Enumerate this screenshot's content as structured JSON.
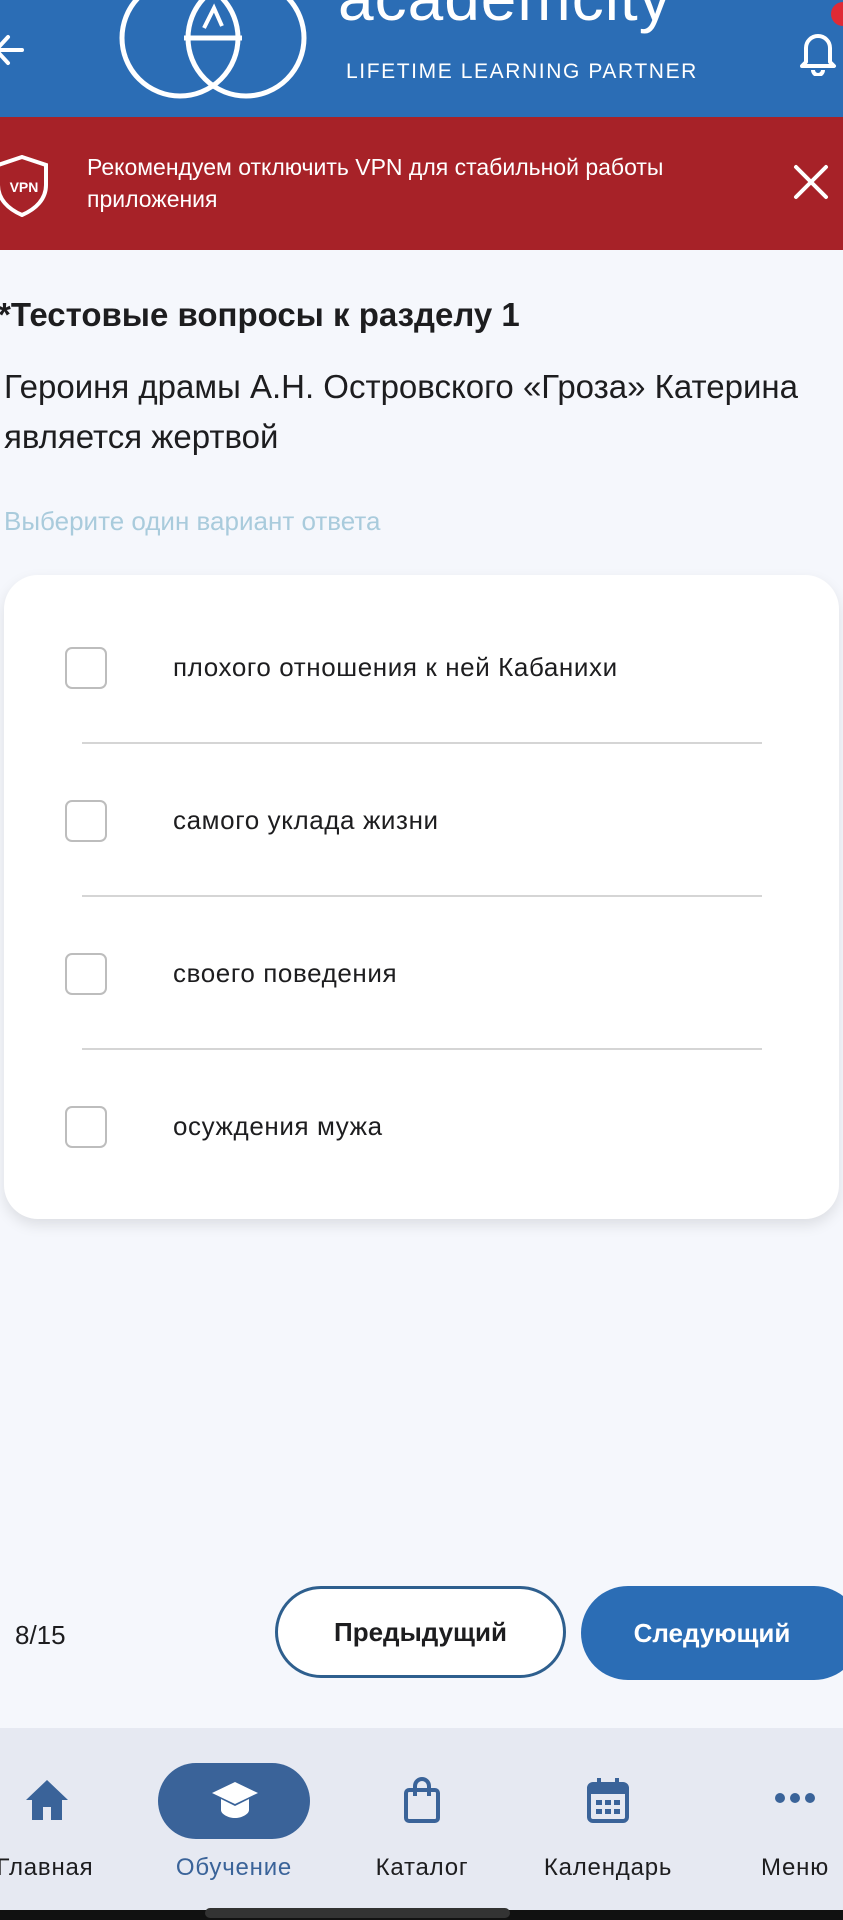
{
  "header": {
    "brand_name": "academcity",
    "brand_tagline": "LIFETIME LEARNING PARTNER",
    "accent_color": "#2b6db5"
  },
  "vpn_banner": {
    "badge": "VPN",
    "message": "Рекомендуем отключить VPN для стабильной работы приложения",
    "color": "#a72228"
  },
  "quiz": {
    "section_title": "*Тестовые вопросы к разделу 1",
    "question": "Героиня драмы А.Н. Островского «Гроза» Катерина является жертвой",
    "hint": "Выберите один вариант ответа",
    "options": [
      {
        "label": "плохого отношения к ней Кабанихи",
        "checked": false
      },
      {
        "label": "самого уклада жизни",
        "checked": false
      },
      {
        "label": "своего поведения",
        "checked": false
      },
      {
        "label": "осуждения мужа",
        "checked": false
      }
    ]
  },
  "pager": {
    "progress": "8/15",
    "prev_label": "Предыдущий",
    "next_label": "Следующий"
  },
  "bottom_nav": {
    "items": [
      {
        "label": "Главная",
        "icon": "home-icon"
      },
      {
        "label": "Обучение",
        "icon": "graduation-cap-icon",
        "active": true
      },
      {
        "label": "Каталог",
        "icon": "shopping-bag-icon"
      },
      {
        "label": "Календарь",
        "icon": "calendar-icon"
      },
      {
        "label": "Меню",
        "icon": "more-icon"
      }
    ],
    "active_color": "#3a6399"
  }
}
